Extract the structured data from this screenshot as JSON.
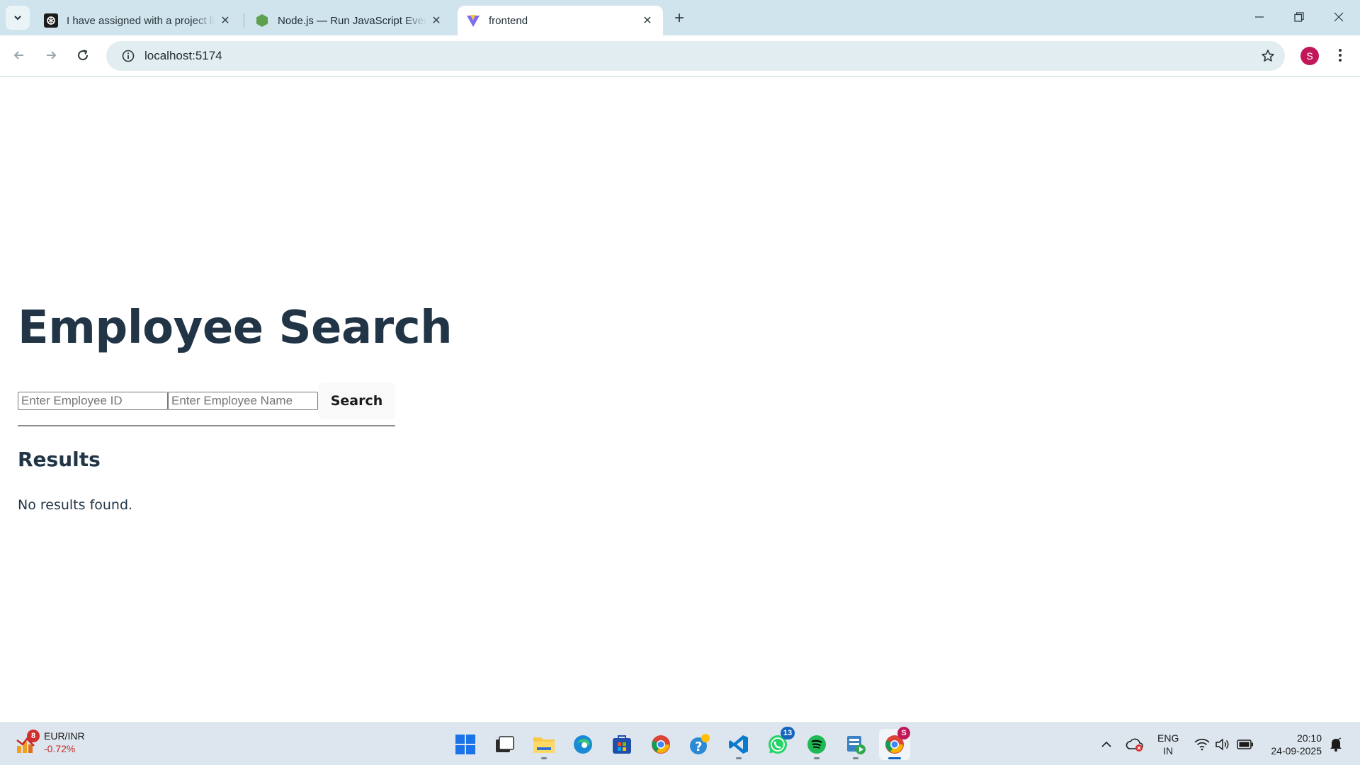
{
  "browser": {
    "tabs": [
      {
        "title": "I have assigned with a project li",
        "favicon": "openai-icon"
      },
      {
        "title": "Node.js — Run JavaScript Every",
        "favicon": "nodejs-icon"
      },
      {
        "title": "frontend",
        "favicon": "vite-icon",
        "active": true
      }
    ],
    "url": "localhost:5174",
    "profile_initial": "S"
  },
  "page": {
    "title": "Employee Search",
    "id_placeholder": "Enter Employee ID",
    "name_placeholder": "Enter Employee Name",
    "search_label": "Search",
    "results_heading": "Results",
    "results_message": "No results found."
  },
  "taskbar": {
    "widget": {
      "badge": "8",
      "title": "EUR/INR",
      "change": "-0.72%"
    },
    "whatsapp_badge": "13",
    "chrome_badge": "S",
    "lang_line1": "ENG",
    "lang_line2": "IN",
    "time": "20:10",
    "date": "24-09-2025"
  }
}
